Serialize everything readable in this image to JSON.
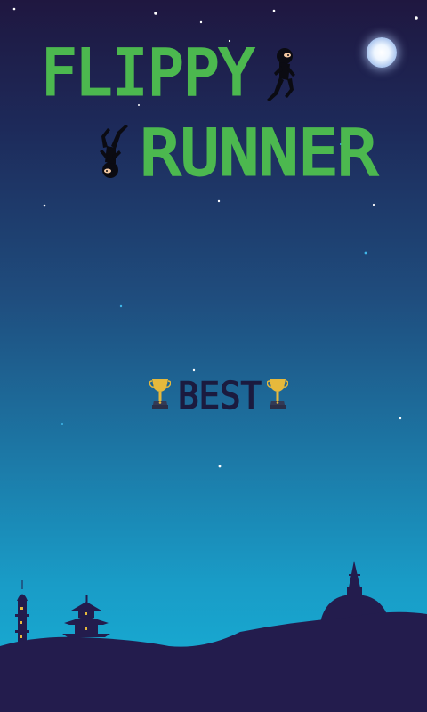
{
  "game": {
    "title_line1": "FLIPPY",
    "title_line2": "RUNNER",
    "best_label": "BEST"
  },
  "colors": {
    "title_green": "#4cb84f",
    "best_navy": "#1b1b3f",
    "silhouette": "#231c4d",
    "trophy_gold": "#e6b93c"
  },
  "icons": {
    "trophy": "trophy-icon",
    "moon": "moon-icon",
    "ninja": "ninja-icon"
  }
}
